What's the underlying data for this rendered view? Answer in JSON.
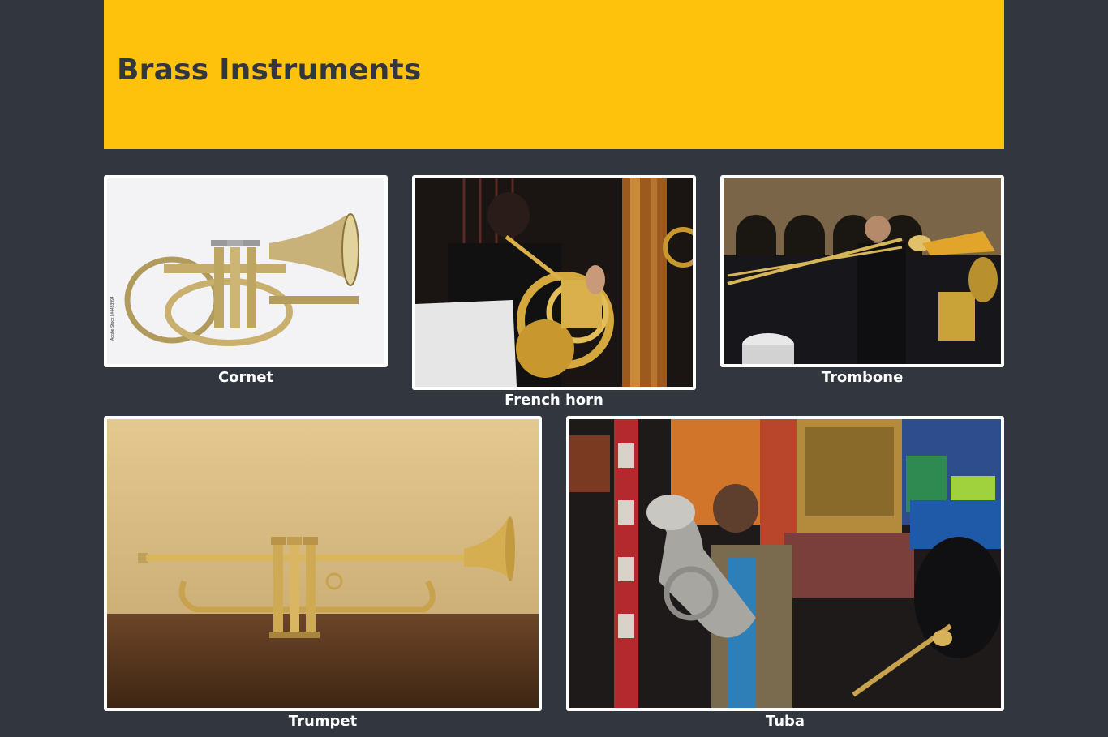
{
  "header": {
    "title": "Brass Instruments",
    "background": "#fec20c",
    "text_color": "#32373f"
  },
  "page_background": "#32373f",
  "gallery": {
    "items": [
      {
        "caption": "Cornet",
        "image": "cornet-photo"
      },
      {
        "caption": "French horn",
        "image": "french-horn-photo"
      },
      {
        "caption": "Trombone",
        "image": "trombone-photo"
      },
      {
        "caption": "Trumpet",
        "image": "trumpet-photo"
      },
      {
        "caption": "Tuba",
        "image": "tuba-photo"
      }
    ]
  }
}
